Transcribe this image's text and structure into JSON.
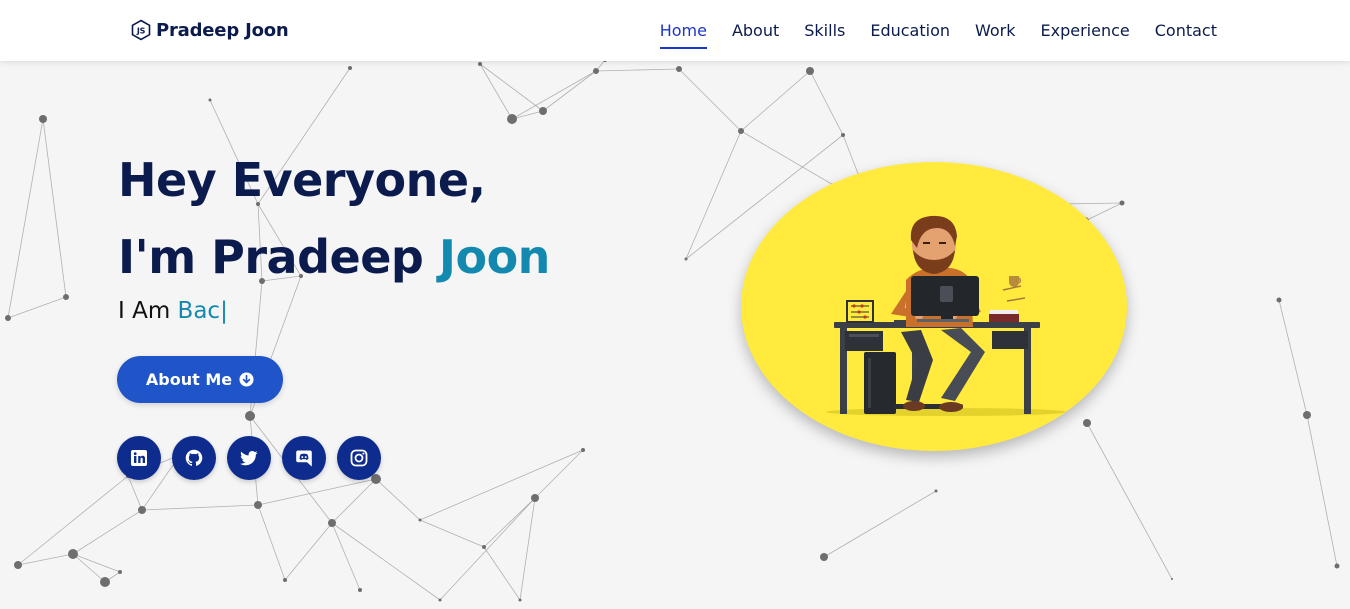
{
  "header": {
    "brand_name": "Pradeep Joon",
    "brand_icon": "nodejs-icon",
    "nav": [
      {
        "label": "Home",
        "active": true
      },
      {
        "label": "About",
        "active": false
      },
      {
        "label": "Skills",
        "active": false
      },
      {
        "label": "Education",
        "active": false
      },
      {
        "label": "Work",
        "active": false
      },
      {
        "label": "Experience",
        "active": false
      },
      {
        "label": "Contact",
        "active": false
      }
    ]
  },
  "hero": {
    "line1": "Hey Everyone,",
    "line2_prefix": "I'm Pradeep ",
    "line2_accent": "Joon",
    "typing_prefix": "I Am ",
    "typing_text": "Bac",
    "typing_cursor": "|",
    "button_label": "About Me",
    "button_icon": "arrow-down-circle-icon"
  },
  "socials": [
    {
      "name": "linkedin",
      "icon": "linkedin-icon"
    },
    {
      "name": "github",
      "icon": "github-icon"
    },
    {
      "name": "twitter",
      "icon": "twitter-icon"
    },
    {
      "name": "discord",
      "icon": "discord-icon"
    },
    {
      "name": "instagram",
      "icon": "instagram-icon"
    }
  ],
  "colors": {
    "navy": "#0b1b4d",
    "accent_teal": "#1489b0",
    "nav_active": "#1b35c9",
    "button_blue": "#1f55c8",
    "social_bg": "#0d2c8e",
    "illustration_bg": "#ffea3d",
    "page_bg": "#f5f5f6"
  }
}
